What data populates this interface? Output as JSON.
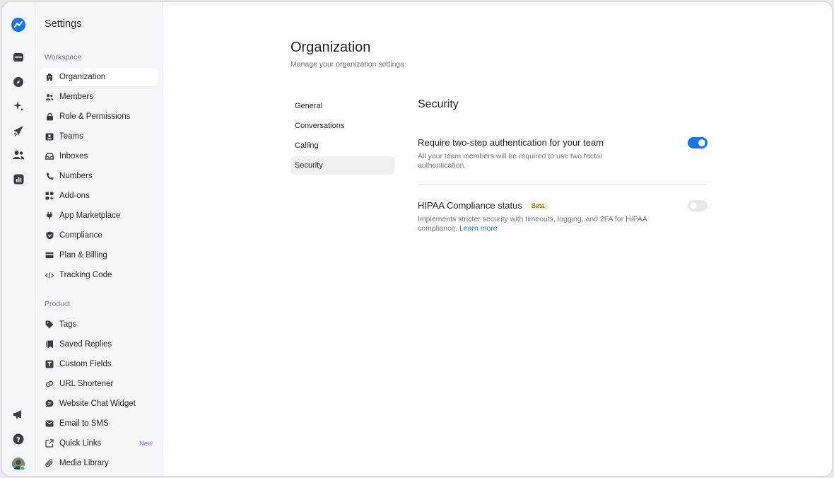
{
  "colors": {
    "accent": "#1677e6",
    "new_badge": "#a855f7",
    "beta_bg": "#fdf3d6"
  },
  "rail": {
    "icons": [
      "logo-icon",
      "inbox-icon",
      "compass-icon",
      "sparkle-icon",
      "send-icon",
      "contacts-icon",
      "analytics-icon",
      "megaphone-icon",
      "help-icon",
      "avatar"
    ]
  },
  "sidebar": {
    "title": "Settings",
    "workspace_label": "Workspace",
    "workspace_items": [
      {
        "label": "Organization",
        "icon": "building-icon",
        "active": true
      },
      {
        "label": "Members",
        "icon": "users-icon"
      },
      {
        "label": "Role & Permissions",
        "icon": "lock-icon"
      },
      {
        "label": "Teams",
        "icon": "id-card-icon"
      },
      {
        "label": "Inboxes",
        "icon": "inbox-icon"
      },
      {
        "label": "Numbers",
        "icon": "phone-icon"
      },
      {
        "label": "Add-ons",
        "icon": "grid-plus-icon"
      },
      {
        "label": "App Marketplace",
        "icon": "plug-icon"
      },
      {
        "label": "Compliance",
        "icon": "shield-icon"
      },
      {
        "label": "Plan & Billing",
        "icon": "credit-card-icon"
      },
      {
        "label": "Tracking Code",
        "icon": "code-icon"
      }
    ],
    "product_label": "Product",
    "product_items": [
      {
        "label": "Tags",
        "icon": "tag-icon"
      },
      {
        "label": "Saved Replies",
        "icon": "bookmark-icon"
      },
      {
        "label": "Custom Fields",
        "icon": "text-field-icon"
      },
      {
        "label": "URL Shortener",
        "icon": "link-icon"
      },
      {
        "label": "Website Chat Widget",
        "icon": "chat-bubble-icon"
      },
      {
        "label": "Email to SMS",
        "icon": "mail-icon"
      },
      {
        "label": "Quick Links",
        "icon": "external-link-icon",
        "badge": "New"
      },
      {
        "label": "Media Library",
        "icon": "paperclip-icon"
      }
    ]
  },
  "main": {
    "title": "Organization",
    "subtitle": "Manage your organization settings",
    "tabs": [
      {
        "label": "General"
      },
      {
        "label": "Conversations"
      },
      {
        "label": "Calling"
      },
      {
        "label": "Security",
        "active": true
      }
    ],
    "section_title": "Security",
    "options": [
      {
        "title": "Require two-step authentication for your team",
        "desc": "All your team members will be required to use two factor authentication.",
        "enabled": true
      },
      {
        "title": "HIPAA Compliance status",
        "badge": "Beta",
        "desc": "Implements stricter security with timeouts, logging, and 2FA for HIPAA compliance.",
        "link": "Learn more",
        "enabled": false
      }
    ]
  }
}
